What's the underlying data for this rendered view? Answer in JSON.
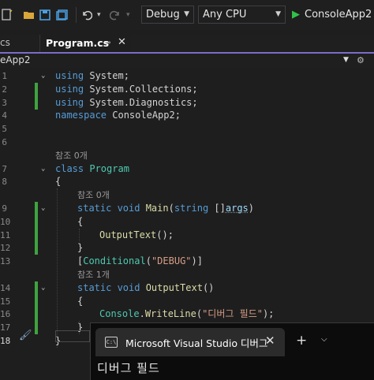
{
  "toolbar": {
    "configuration": "Debug",
    "platform": "Any CPU",
    "run_target": "ConsoleApp2",
    "icons": [
      "new-item-icon",
      "open-folder-icon",
      "save-icon",
      "save-all-icon",
      "undo-icon",
      "redo-icon",
      "play-icon"
    ]
  },
  "tabs": {
    "inactive_label": "cs",
    "active_label": "Program.cs",
    "pin_glyph": "⊸",
    "close_glyph": "✕"
  },
  "navbar": {
    "project": "eApp2"
  },
  "editor": {
    "lines": [
      {
        "num": "1",
        "parts": [
          [
            "kw",
            "using"
          ],
          [
            "",
            "System;"
          ]
        ]
      },
      {
        "num": "2",
        "parts": [
          [
            "kw",
            "using"
          ],
          [
            "",
            "System.Collections;"
          ]
        ]
      },
      {
        "num": "3",
        "parts": [
          [
            "kw",
            "using"
          ],
          [
            "",
            "System.Diagnostics;"
          ]
        ]
      },
      {
        "num": "4",
        "parts": [
          [
            "kw",
            "namespace"
          ],
          [
            "",
            "ConsoleApp2;"
          ]
        ]
      },
      {
        "num": "5",
        "parts": []
      },
      {
        "num": "6",
        "parts": []
      },
      {
        "num": "",
        "ref": "참조 0개"
      },
      {
        "num": "7",
        "parts": [
          [
            "kw",
            "class"
          ],
          [
            "ty",
            "Program"
          ]
        ]
      },
      {
        "num": "8",
        "parts": [
          [
            "",
            "{"
          ]
        ]
      },
      {
        "num": "",
        "ref": "참조 0개"
      },
      {
        "num": "9",
        "parts": [
          [
            "kw",
            "static"
          ],
          [
            "kw",
            "void"
          ],
          [
            "fn",
            "Main"
          ],
          [
            "",
            "("
          ],
          [
            "kw",
            "string"
          ],
          [
            "",
            "[]"
          ],
          [
            "pm",
            "args"
          ],
          [
            "",
            ")"
          ]
        ]
      },
      {
        "num": "10",
        "parts": [
          [
            "",
            "{"
          ]
        ]
      },
      {
        "num": "11",
        "parts": [
          [
            "fn",
            "OutputText"
          ],
          [
            "",
            "();"
          ]
        ]
      },
      {
        "num": "12",
        "parts": [
          [
            "",
            "}"
          ]
        ]
      },
      {
        "num": "13",
        "parts": [
          [
            "",
            "["
          ],
          [
            "ty",
            "Conditional"
          ],
          [
            "",
            "("
          ],
          [
            "st",
            "\"DEBUG\""
          ],
          [
            "",
            ")]"
          ]
        ]
      },
      {
        "num": "",
        "ref": "참조 1개"
      },
      {
        "num": "14",
        "parts": [
          [
            "kw",
            "static"
          ],
          [
            "kw",
            "void"
          ],
          [
            "fn",
            "OutputText"
          ],
          [
            "",
            "()"
          ]
        ]
      },
      {
        "num": "15",
        "parts": [
          [
            "",
            "{"
          ]
        ]
      },
      {
        "num": "16",
        "parts": [
          [
            "ty",
            "Console"
          ],
          [
            "",
            "."
          ],
          [
            "fn",
            "WriteLine"
          ],
          [
            "",
            "("
          ],
          [
            "st",
            "\"디버그 필드\""
          ],
          [
            "",
            ");"
          ]
        ]
      },
      {
        "num": "17",
        "parts": [
          [
            "",
            "}"
          ]
        ]
      },
      {
        "num": "18",
        "parts": [
          [
            "",
            "}"
          ]
        ]
      }
    ]
  },
  "terminal": {
    "tab_title": "Microsoft Visual Studio 디버그",
    "icon_text": "C:\\",
    "close_glyph": "✕",
    "new_tab_glyph": "+",
    "dropdown_glyph": "⌄",
    "output": "디버그 필드"
  }
}
